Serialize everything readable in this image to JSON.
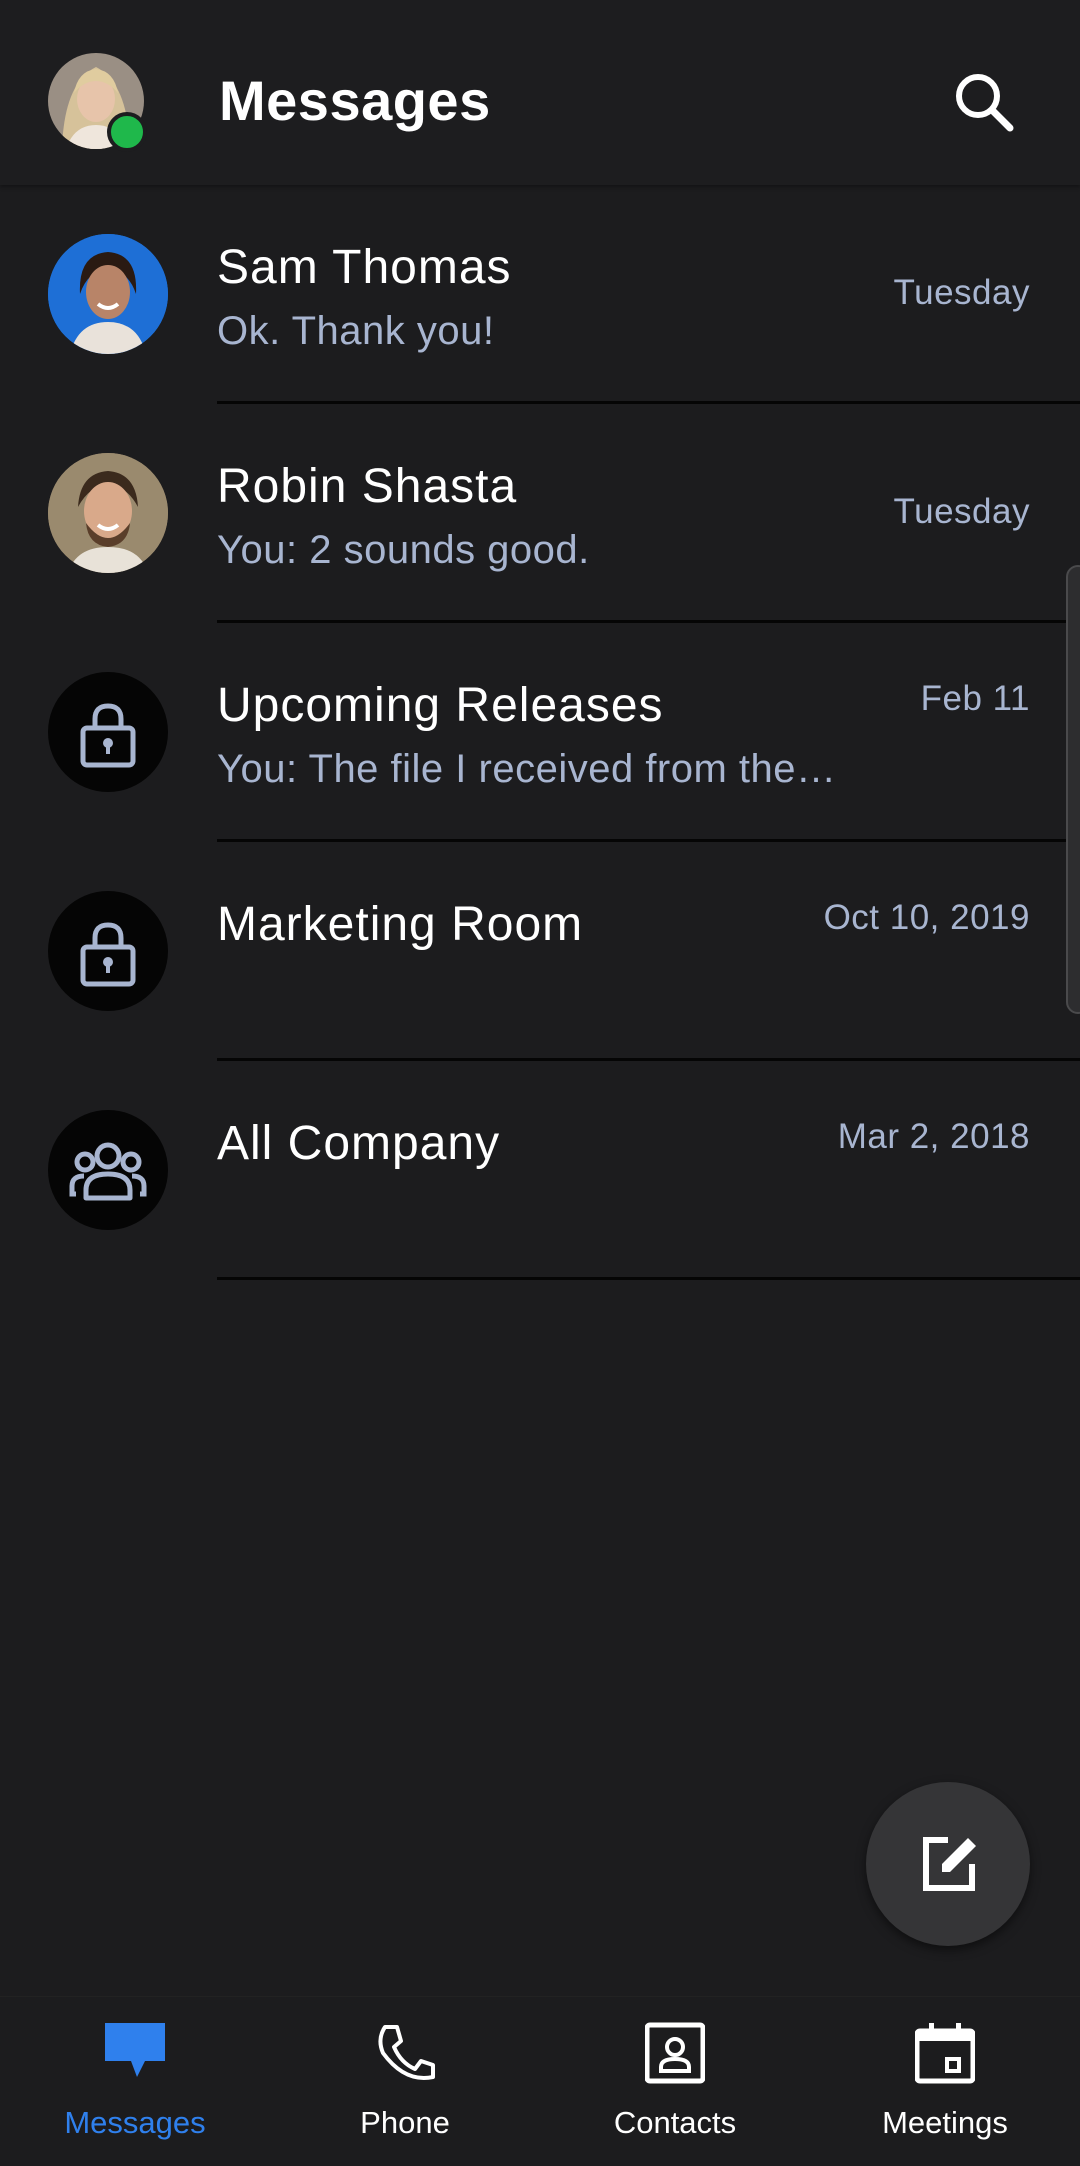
{
  "header": {
    "title": "Messages",
    "presence_status_color": "#1fb84b",
    "search_icon": "search-icon"
  },
  "conversations": [
    {
      "name": "Sam Thomas",
      "preview": "Ok. Thank you!",
      "date": "Tuesday",
      "avatar": "photo-woman"
    },
    {
      "name": "Robin Shasta",
      "preview": "You: 2 sounds good.",
      "date": "Tuesday",
      "avatar": "photo-man"
    },
    {
      "name": "Upcoming Releases",
      "preview": "You: The file I received from the…",
      "date": "Feb 11",
      "avatar": "lock-icon"
    },
    {
      "name": "Marketing Room",
      "preview": "",
      "date": "Oct 10, 2019",
      "avatar": "lock-icon"
    },
    {
      "name": "All Company",
      "preview": "",
      "date": "Mar 2, 2018",
      "avatar": "group-icon"
    }
  ],
  "fab": {
    "icon": "compose-icon"
  },
  "nav": {
    "accent_color": "#2f80ed",
    "tabs": [
      {
        "label": "Messages",
        "icon": "chat-bubble-icon",
        "active": true
      },
      {
        "label": "Phone",
        "icon": "phone-icon",
        "active": false
      },
      {
        "label": "Contacts",
        "icon": "contact-card-icon",
        "active": false
      },
      {
        "label": "Meetings",
        "icon": "calendar-icon",
        "active": false
      }
    ]
  }
}
